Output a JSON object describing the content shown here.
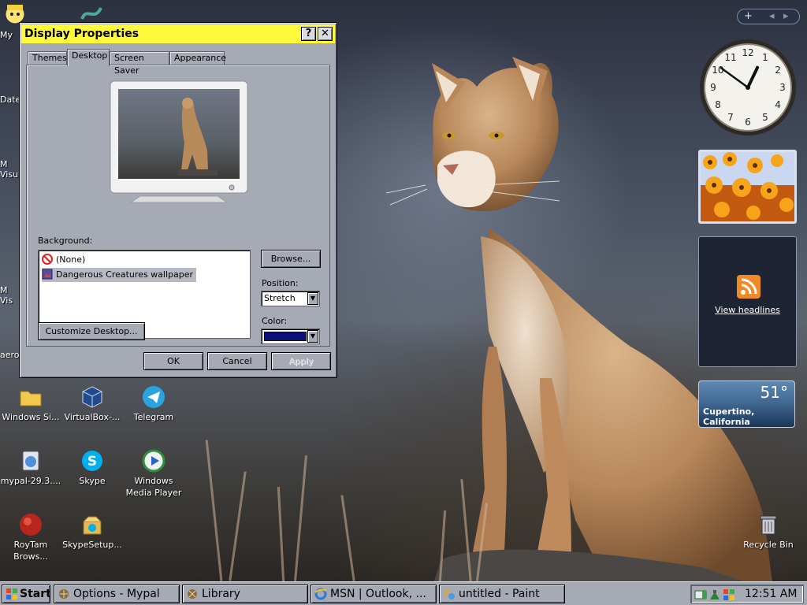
{
  "window": {
    "title": "Display Properties",
    "help_label": "?",
    "close_label": "✕",
    "tabs": [
      "Themes",
      "Desktop",
      "Screen Saver",
      "Appearance"
    ],
    "active_tab": "Desktop",
    "background_label": "Background:",
    "background_items": [
      {
        "label": "(None)",
        "icon": "no-entry-icon",
        "selected": false
      },
      {
        "label": "Dangerous Creatures wallpaper",
        "icon": "wallpaper-icon",
        "selected": true
      }
    ],
    "browse_label": "Browse...",
    "position_label": "Position:",
    "position_value": "Stretch",
    "color_label": "Color:",
    "color_value": "#0c0f7a",
    "customize_label": "Customize Desktop...",
    "ok_label": "OK",
    "cancel_label": "Cancel",
    "apply_label": "Apply"
  },
  "desktop": {
    "icons": [
      {
        "label": "Windows Si...",
        "icon": "folder-icon"
      },
      {
        "label": "VirtualBox-...",
        "icon": "virtualbox-icon"
      },
      {
        "label": "Telegram",
        "icon": "telegram-icon"
      },
      {
        "label": "mypal-29.3....",
        "icon": "installer-icon"
      },
      {
        "label": "Skype",
        "icon": "skype-icon"
      },
      {
        "label": "Windows\nMedia Player",
        "icon": "media-player-icon"
      },
      {
        "label": "RoyTam\nBrows...",
        "icon": "browser-icon"
      },
      {
        "label": "SkypeSetup...",
        "icon": "setup-box-icon"
      },
      {
        "label": "Recycle Bin",
        "icon": "recycle-bin-icon"
      }
    ],
    "partial_labels": [
      "My",
      "Date",
      "M\nVisu",
      "M\nVis",
      "aero"
    ]
  },
  "gadgets": {
    "controls": {
      "add": "+",
      "prev": "◂",
      "next": "▸"
    },
    "clock": {
      "numbers": [
        "12",
        "1",
        "2",
        "3",
        "4",
        "5",
        "6",
        "7",
        "8",
        "9",
        "10",
        "11"
      ],
      "hour": 12,
      "minute": 51
    },
    "feed": {
      "label": "View headlines"
    },
    "weather": {
      "temp": "51°",
      "location": "Cupertino, California"
    }
  },
  "taskbar": {
    "start_label": "Start",
    "items": [
      {
        "label": "Options - Mypal",
        "icon": "mypal-icon"
      },
      {
        "label": "Library",
        "icon": "library-icon"
      },
      {
        "label": "MSN | Outlook, ...",
        "icon": "ie-icon"
      },
      {
        "label": "untitled - Paint",
        "icon": "paint-icon"
      }
    ],
    "clock": "12:51 AM"
  },
  "colors": {
    "title_bar": "#fffa3c",
    "window_face": "#a6aab4",
    "selection": "#b7bac3"
  }
}
